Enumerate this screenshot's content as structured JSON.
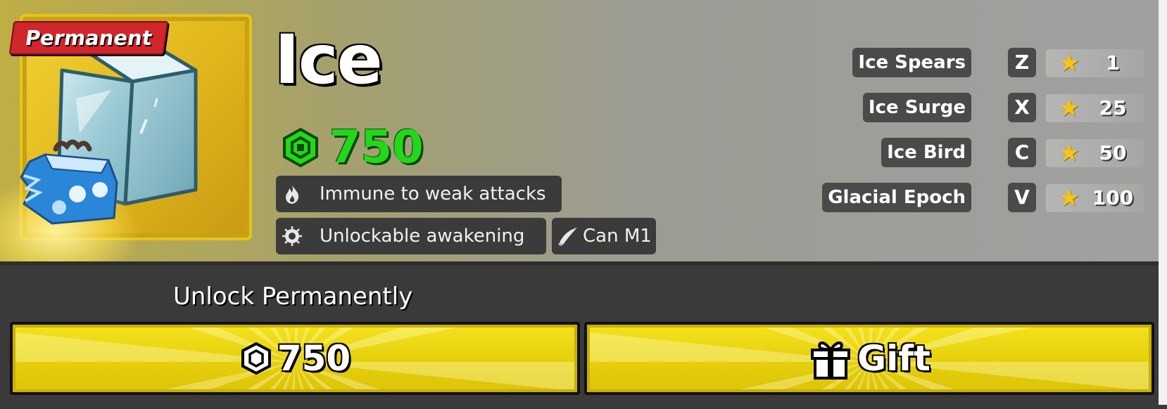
{
  "fruit": {
    "badge": "Permanent",
    "name": "Ice",
    "price": "750"
  },
  "traits": [
    {
      "icon": "flame-icon",
      "label": "Immune to weak attacks"
    },
    {
      "icon": "awakening-eye-icon",
      "label": "Unlockable awakening"
    },
    {
      "icon": "blade-icon",
      "label": "Can M1"
    }
  ],
  "moves": [
    {
      "name": "Ice Spears",
      "key": "Z",
      "level": "1"
    },
    {
      "name": "Ice Surge",
      "key": "X",
      "level": "25"
    },
    {
      "name": "Ice Bird",
      "key": "C",
      "level": "50"
    },
    {
      "name": "Glacial Epoch",
      "key": "V",
      "level": "100"
    }
  ],
  "unlock": {
    "label": "Unlock Permanently",
    "robux_button": "750",
    "gift_button": "Gift"
  },
  "colors": {
    "price_green": "#22d81a",
    "button_yellow": "#ecd412",
    "badge_red": "#d0262c",
    "card_gold": "#e6c31f"
  }
}
